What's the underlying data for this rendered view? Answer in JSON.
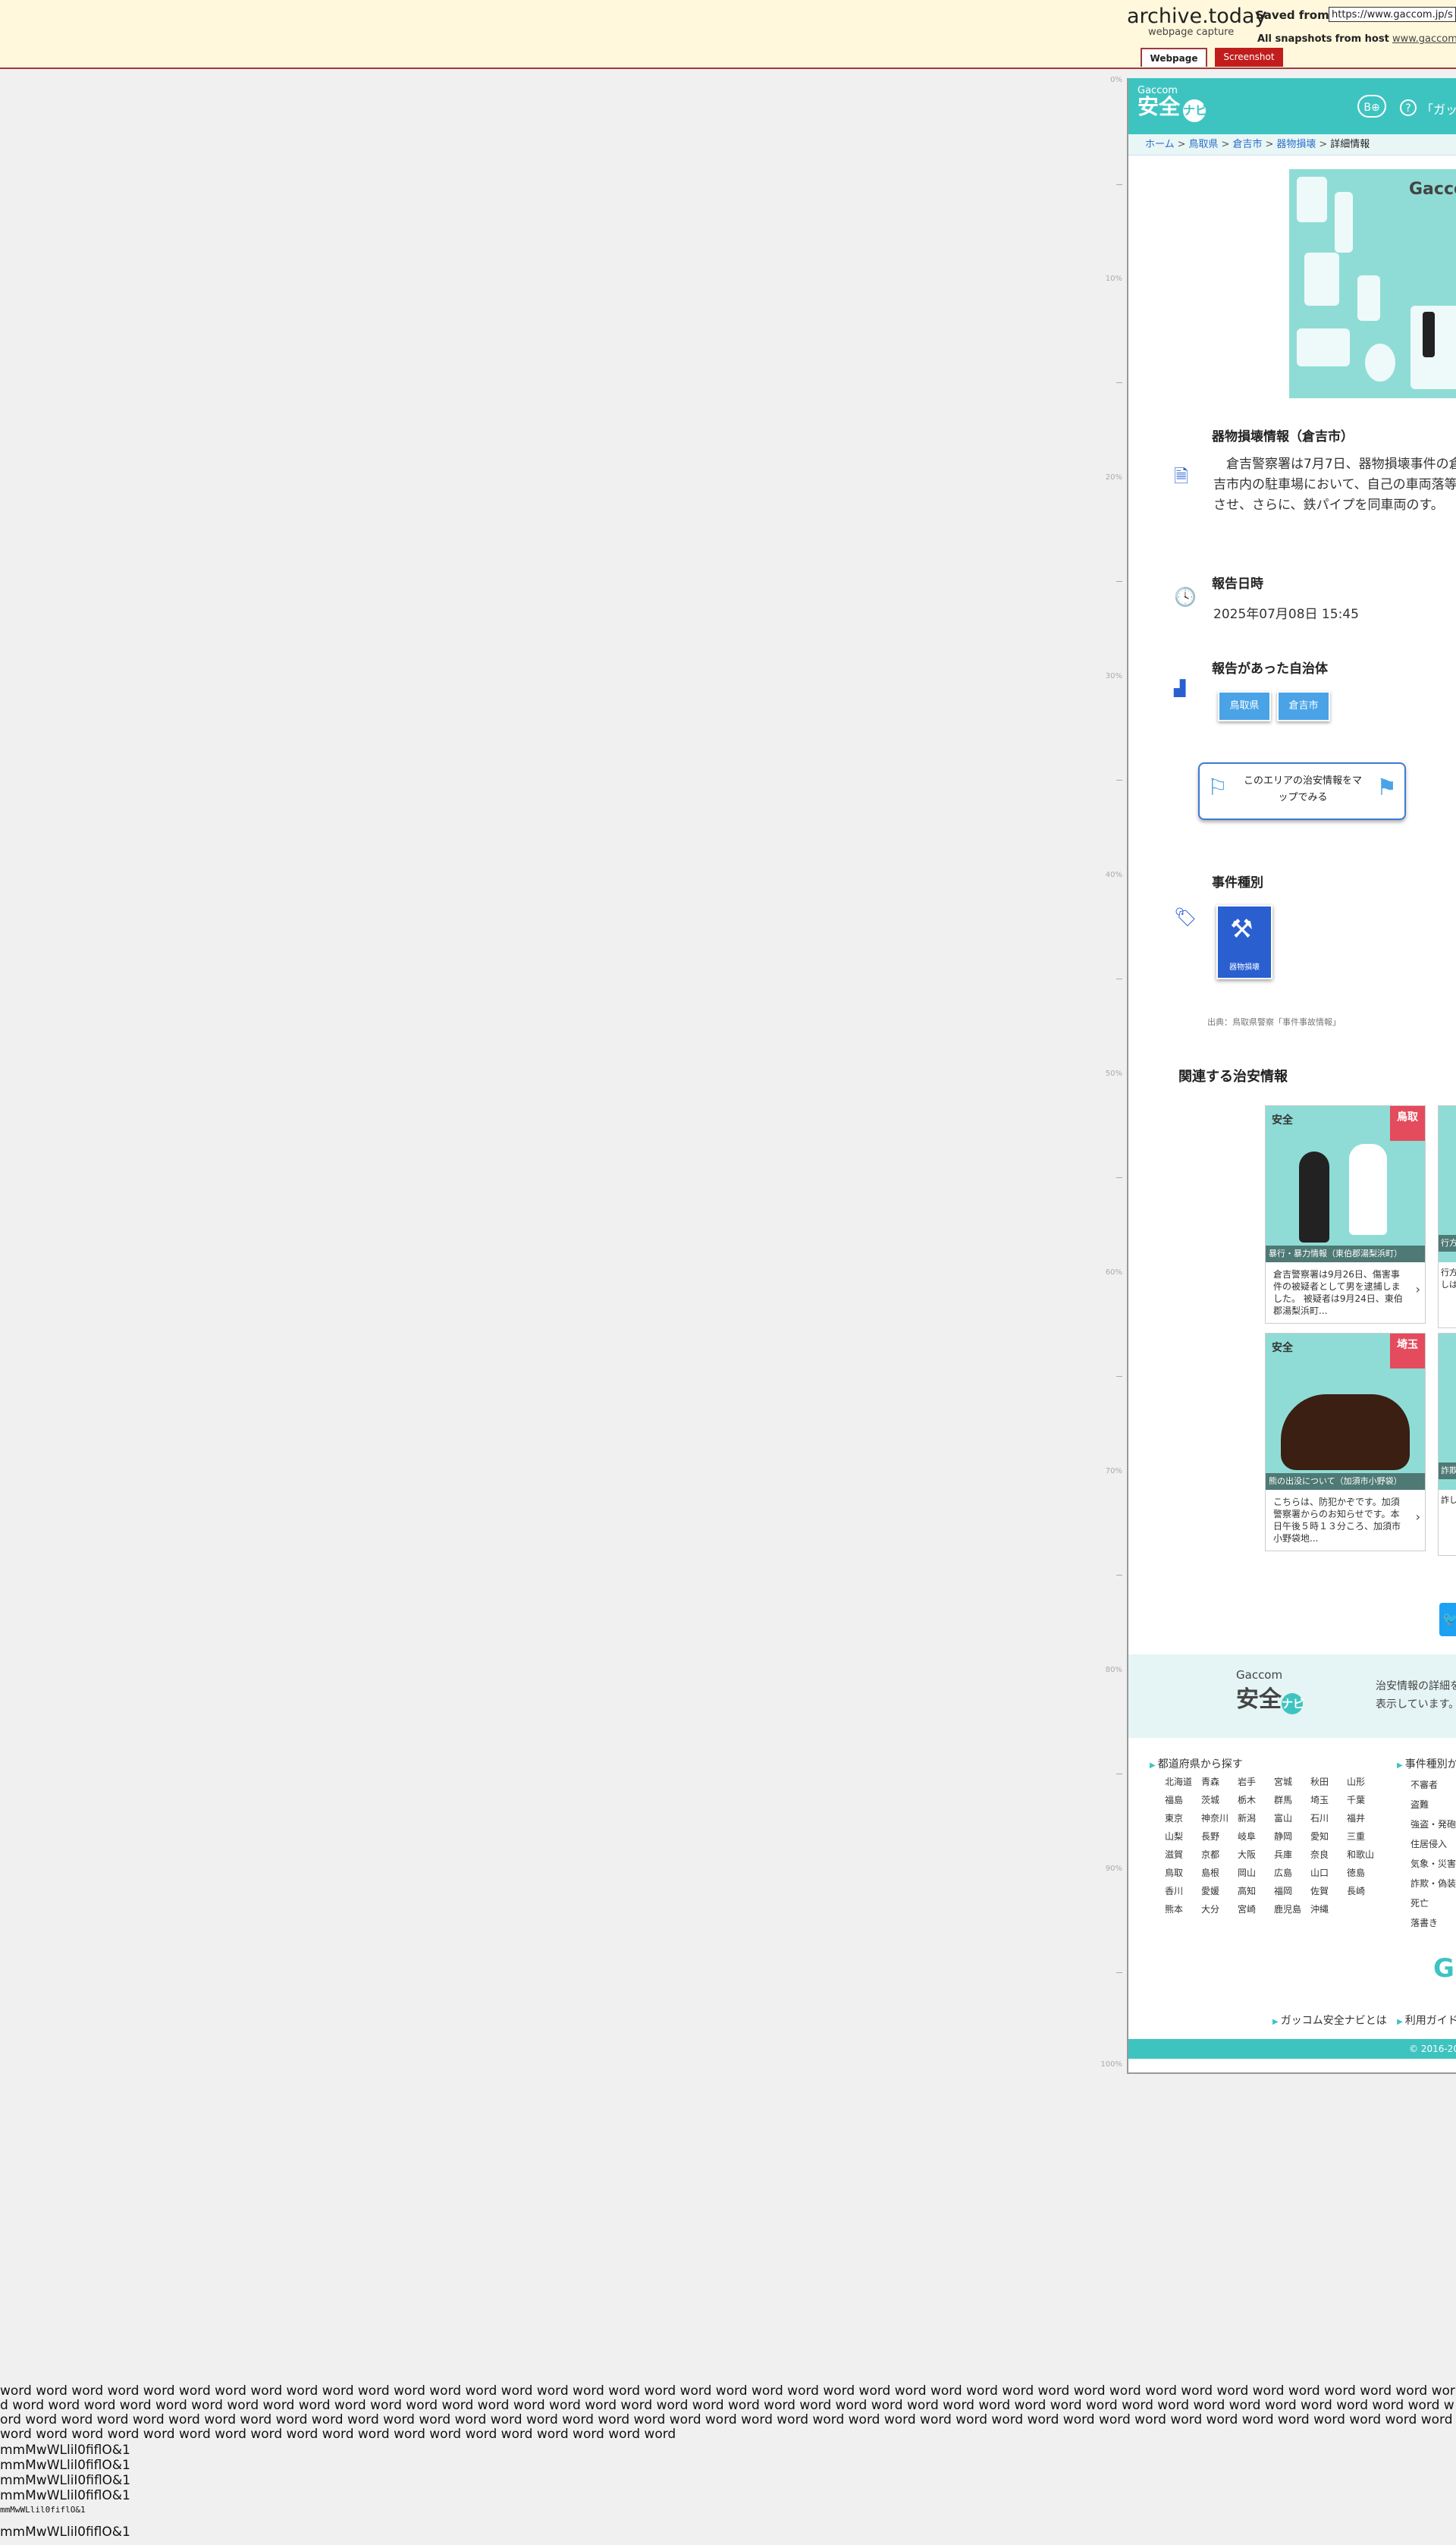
{
  "archive": {
    "logo": "archive.today",
    "subtitle": "webpage capture",
    "saved_from_label": "Saved from",
    "saved_url": "https://www.gaccom.jp/s",
    "all_snapshots_label": "All snapshots",
    "from_host_label": "from host",
    "host": "www.gaccom.jp",
    "tab_webpage": "Webpage",
    "tab_screenshot": "Screenshot"
  },
  "ruler": [
    "0%",
    "10%",
    "20%",
    "30%",
    "40%",
    "50%",
    "60%",
    "70%",
    "80%",
    "90%",
    "100%"
  ],
  "site": {
    "logo_small": "Gaccom",
    "logo_big": "安全",
    "logo_navi": "ナビ",
    "header_icon_1": "B",
    "header_icon_2": "⊕",
    "help_icon": "?",
    "header_link": "「ガッ"
  },
  "breadcrumb": [
    "ホーム",
    "鳥取県",
    "倉吉市",
    "器物損壊",
    "詳細情報"
  ],
  "hero": {
    "logo": "Gaccom 安全"
  },
  "article": {
    "title": "器物損壊情報（倉吉市）",
    "body": "　倉吉警察署は7月7日、器物損壊事件の倉吉市内の駐車場において、自己の車両落等させ、さらに、鉄パイプを同車両のす。",
    "date_label": "報告日時",
    "date_value": "2025年07月08日 15:45",
    "muni_label": "報告があった自治体",
    "muni_buttons": [
      "鳥取県",
      "倉吉市"
    ],
    "map_button": "このエリアの治安情報をマップでみる",
    "category_label": "事件種別",
    "category_tile": "器物損壊",
    "source": "出典：鳥取県警察「事件事故情報」"
  },
  "related": {
    "title": "関連する治安情報",
    "cards": [
      {
        "ribbon": "鳥取",
        "caption": "暴行・暴力情報（東伯郡湯梨浜町）",
        "desc": "倉吉警察署は9月26日、傷害事件の被疑者として男を逮捕しました。 被疑者は9月24日、東伯郡湯梨浜町..."
      },
      {
        "ribbon": "埼玉",
        "caption": "熊の出没について（加須市小野袋）",
        "desc": "こちらは、防犯かぞです。加須警察署からのお知らせです。本日午後５時１３分ころ、加須市小野袋地..."
      }
    ],
    "partial_cards": [
      {
        "caption": "行方",
        "desc": "行方のしはは"
      },
      {
        "caption": "詐欺",
        "desc": "詐しし"
      }
    ]
  },
  "footer": {
    "logo_small": "Gaccom",
    "logo_big": "安全",
    "logo_navi": "ナビ",
    "desc": "治安情報の詳細を表示しています。",
    "pref_head": "都道府県から探す",
    "case_head": "事件種別か",
    "prefs": [
      "北海道",
      "青森",
      "岩手",
      "宮城",
      "秋田",
      "山形",
      "福島",
      "茨城",
      "栃木",
      "群馬",
      "埼玉",
      "千葉",
      "東京",
      "神奈川",
      "新潟",
      "富山",
      "石川",
      "福井",
      "山梨",
      "長野",
      "岐阜",
      "静岡",
      "愛知",
      "三重",
      "滋賀",
      "京都",
      "大阪",
      "兵庫",
      "奈良",
      "和歌山",
      "鳥取",
      "島根",
      "岡山",
      "広島",
      "山口",
      "徳島",
      "香川",
      "愛媛",
      "高知",
      "福岡",
      "佐賀",
      "長崎",
      "熊本",
      "大分",
      "宮崎",
      "鹿児島",
      "沖縄"
    ],
    "cases": [
      "不審者",
      "盗難",
      "強盗・発砲",
      "住居侵入",
      "気象・災害",
      "詐欺・偽装",
      "死亡",
      "落書き"
    ],
    "gl": "G",
    "link_about": "ガッコム安全ナビとは",
    "link_guide": "利用ガイド",
    "copyright": "© 2016-20"
  },
  "filler": {
    "words": "word word word word word word word word word word word word word word word word word word word word word word word word word word word word word word word word word word word word word word word word word word word word word word word word word word word word word word word word word word word word word word word word word word word word word word word word word word word word word word word word word word word word word word word word word word word word word word word word word word word word word word word word word word word word word word word word word word word word word word word word word word word word word word word word word word word word word word word word word word word word word",
    "glyphs": [
      "mmMwWLlil0fiflO&1",
      "mmMwWLlil0fiflO&1",
      "mmMwWLlil0fiflO&1",
      "mmMwWLlil0fiflO&1",
      "mmMwWLliI0fiflO&1",
      "mmMwWLlil0fiflO&1"
    ]
  }
}
